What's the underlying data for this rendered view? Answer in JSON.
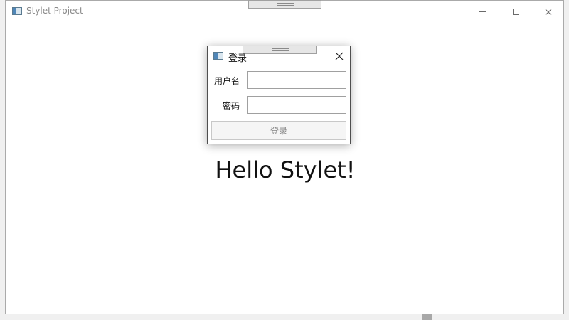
{
  "window": {
    "title": "Stylet Project",
    "icon": "app-window-icon",
    "controls": {
      "minimize": "minimize-icon",
      "maximize": "maximize-icon",
      "close": "close-icon"
    }
  },
  "main": {
    "greeting": "Hello Stylet!"
  },
  "dialog": {
    "title": "登录",
    "icon": "dialog-window-icon",
    "close_icon": "close-icon",
    "username_label": "用户名",
    "username_value": "",
    "password_label": "密码",
    "password_value": "",
    "login_button": "登录"
  },
  "colors": {
    "window_background": "#ffffff",
    "desktop_background": "#f0f0f0",
    "disabled_text": "#838383",
    "border": "#a0a0a0"
  }
}
